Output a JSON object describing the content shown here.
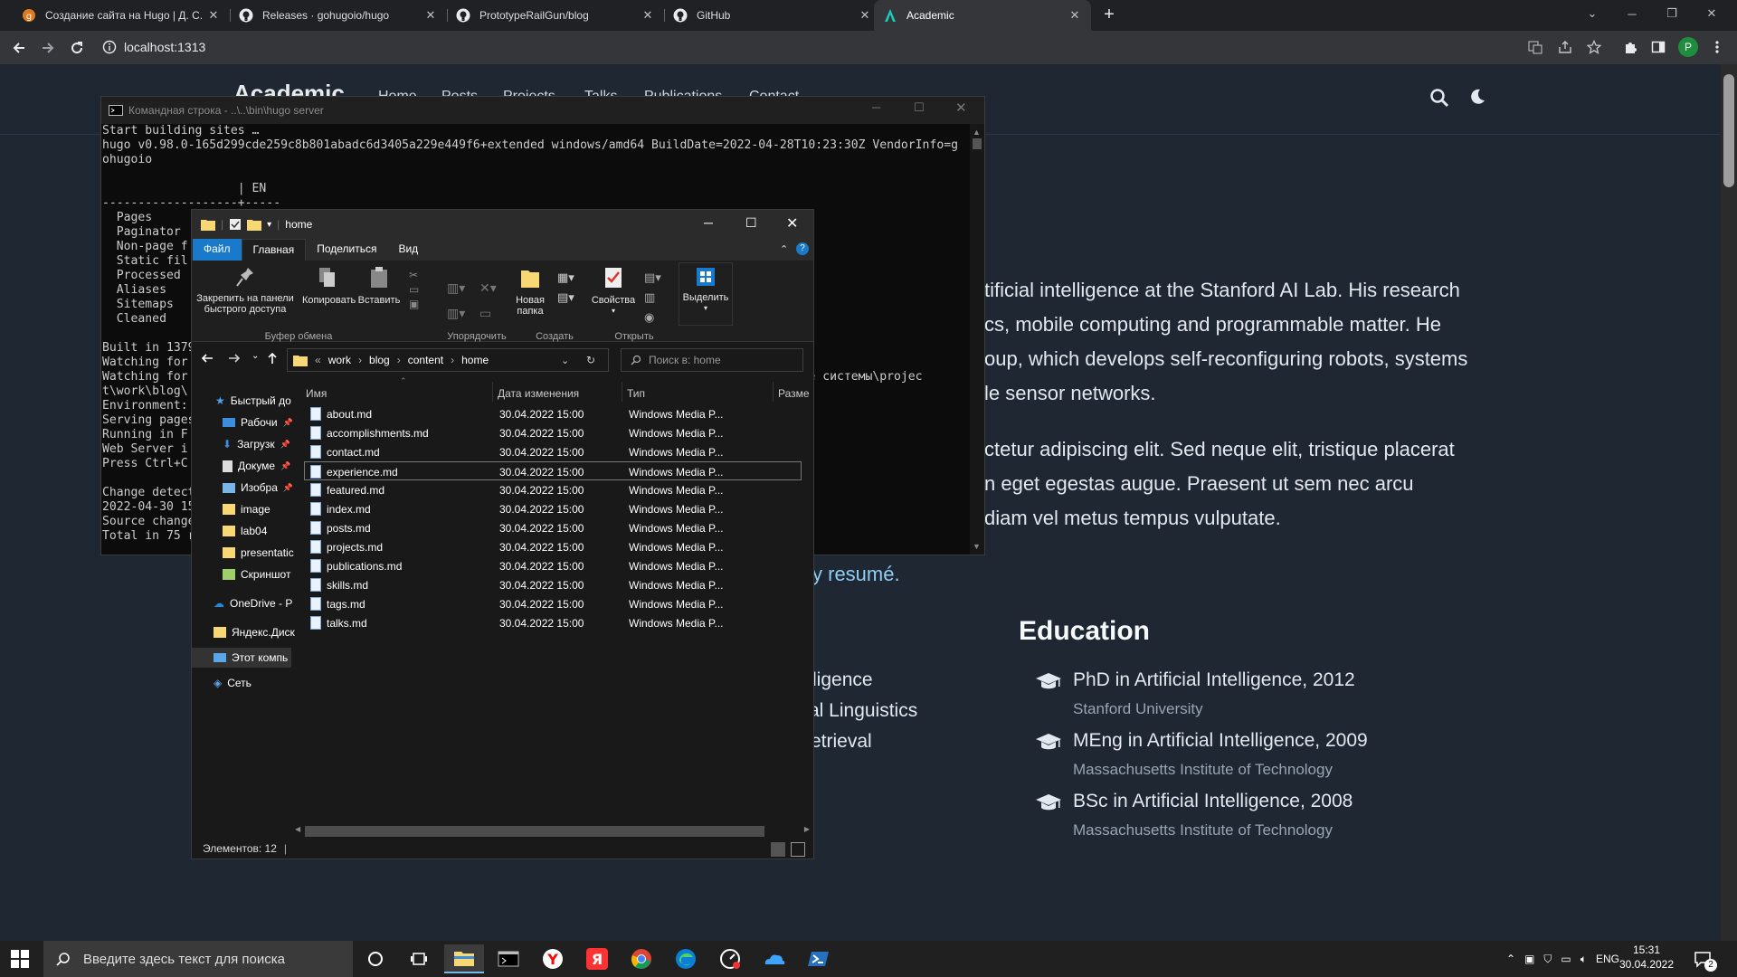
{
  "browser": {
    "tabs": [
      {
        "title": "Создание сайта на Hugo | Д. С. ..."
      },
      {
        "title": "Releases · gohugoio/hugo"
      },
      {
        "title": "PrototypeRailGun/blog"
      },
      {
        "title": "GitHub"
      },
      {
        "title": "Academic"
      }
    ],
    "url": "localhost:1313",
    "profile_letter": "P"
  },
  "site": {
    "brand": "Academic",
    "nav": [
      "Home",
      "Posts",
      "Projects",
      "Talks",
      "Publications",
      "Contact"
    ],
    "bio_lines": [
      "tificial intelligence at the Stanford AI Lab. His research",
      "cs, mobile computing and programmable matter. He",
      "oup, which develops self-reconfiguring robots, systems",
      "le sensor networks.",
      "ctetur adipiscing elit. Sed neque elit, tristique placerat",
      "n eget egestas augue. Praesent ut sem nec arcu",
      "diam vel metus tempus vulputate."
    ],
    "resume_link": "y resumé.",
    "interests": [
      "ligence",
      "al Linguistics",
      "etrieval"
    ],
    "education_title": "Education",
    "education": [
      {
        "degree": "PhD in Artificial Intelligence, 2012",
        "institution": "Stanford University"
      },
      {
        "degree": "MEng in Artificial Intelligence, 2009",
        "institution": "Massachusetts Institute of Technology"
      },
      {
        "degree": "BSc in Artificial Intelligence, 2008",
        "institution": "Massachusetts Institute of Technology"
      }
    ]
  },
  "cmd": {
    "title": "Командная строка - ..\\..\\bin\\hugo  server",
    "lines": [
      "Start building sites …",
      "hugo v0.98.0-165d299cde259c8b801abadc6d3405a229e449f6+extended windows/amd64 BuildDate=2022-04-28T10:23:30Z VendorInfo=g",
      "ohugoio",
      "",
      "                   | EN",
      "-------------------+-----",
      "  Pages            |",
      "  Paginator",
      "  Non-page f",
      "  Static fil",
      "  Processed",
      "  Aliases",
      "  Sitemaps",
      "  Cleaned",
      "",
      "Built in 1379",
      "Watching for",
      "Watching for                                                                                 ционные системы\\projec",
      "t\\work\\blog\\",
      "Environment:",
      "Serving pages",
      "Running in F",
      "Web Server i",
      "Press Ctrl+C",
      "",
      "Change detect",
      "2022-04-30 15",
      "Source change",
      "Total in 75 r"
    ]
  },
  "explorer": {
    "title": "home",
    "ribbon_tabs": [
      "Файл",
      "Главная",
      "Поделиться",
      "Вид"
    ],
    "ribbon_buttons": {
      "pin": "Закрепить на панели быстрого доступа",
      "copy": "Копировать",
      "paste": "Вставить",
      "new_folder": "Новая папка",
      "properties": "Свойства",
      "select": "Выделить"
    },
    "ribbon_groups": [
      "Буфер обмена",
      "Упорядочить",
      "Создать",
      "Открыть"
    ],
    "path": [
      "work",
      "blog",
      "content",
      "home"
    ],
    "search_placeholder": "Поиск в: home",
    "nav_items": [
      "Быстрый до",
      "Рабочи",
      "Загрузк",
      "Докуме",
      "Изобра",
      "image",
      "lab04",
      "presentatic",
      "Скриншот",
      "OneDrive - P",
      "Яндекс.Диск",
      "Этот компь",
      "Сеть"
    ],
    "columns": [
      "Имя",
      "Дата изменения",
      "Тип",
      "Разме"
    ],
    "files": [
      {
        "name": "about.md",
        "date": "30.04.2022 15:00",
        "type": "Windows Media P..."
      },
      {
        "name": "accomplishments.md",
        "date": "30.04.2022 15:00",
        "type": "Windows Media P..."
      },
      {
        "name": "contact.md",
        "date": "30.04.2022 15:00",
        "type": "Windows Media P..."
      },
      {
        "name": "experience.md",
        "date": "30.04.2022 15:00",
        "type": "Windows Media P..."
      },
      {
        "name": "featured.md",
        "date": "30.04.2022 15:00",
        "type": "Windows Media P..."
      },
      {
        "name": "index.md",
        "date": "30.04.2022 15:00",
        "type": "Windows Media P..."
      },
      {
        "name": "posts.md",
        "date": "30.04.2022 15:00",
        "type": "Windows Media P..."
      },
      {
        "name": "projects.md",
        "date": "30.04.2022 15:00",
        "type": "Windows Media P..."
      },
      {
        "name": "publications.md",
        "date": "30.04.2022 15:00",
        "type": "Windows Media P..."
      },
      {
        "name": "skills.md",
        "date": "30.04.2022 15:00",
        "type": "Windows Media P..."
      },
      {
        "name": "tags.md",
        "date": "30.04.2022 15:00",
        "type": "Windows Media P..."
      },
      {
        "name": "talks.md",
        "date": "30.04.2022 15:00",
        "type": "Windows Media P..."
      }
    ],
    "status": "Элементов: 12"
  },
  "taskbar": {
    "search_placeholder": "Введите здесь текст для поиска",
    "lang": "ENG",
    "time": "15:31",
    "date": "30.04.2022",
    "notification_count": "2"
  },
  "colors": {
    "accent": "#1979ca",
    "site_bg": "#1f2733",
    "link": "#90cdf4"
  }
}
